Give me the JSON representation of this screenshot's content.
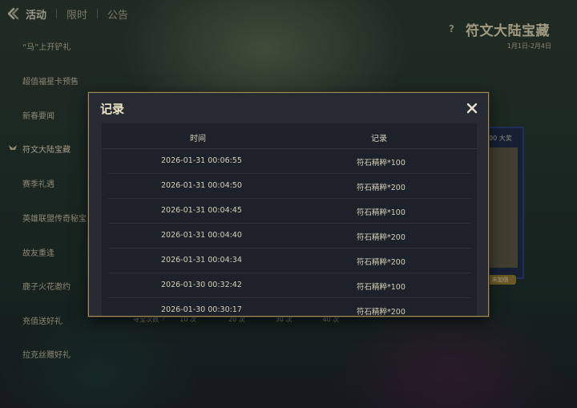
{
  "topnav": {
    "tab_activity": "活动",
    "tab_limited": "限时",
    "tab_notice": "公告"
  },
  "sidebar": {
    "items": [
      {
        "label": "“马”上开铲礼"
      },
      {
        "label": "超值福星卡预售"
      },
      {
        "label": "新春要闻"
      },
      {
        "label": "符文大陆宝藏"
      },
      {
        "label": "赛季礼遇"
      },
      {
        "label": "英雄联盟传奇秘宝"
      },
      {
        "label": "故友重逢"
      },
      {
        "label": "鹿子火花邀约"
      },
      {
        "label": "充值送好礼"
      },
      {
        "label": "拉克丝赠好礼"
      }
    ],
    "active_index": 3
  },
  "event": {
    "help": "?",
    "title": "符文大陆宝藏",
    "date": "1月1日-2月4日"
  },
  "background_panel": {
    "prize_text": "00 大奖",
    "badge_text": "末加倍",
    "count_label": "寻宝次数",
    "count_help": "?",
    "count_10": "10 次",
    "count_20": "20 次",
    "count_30": "30 次",
    "count_40": "40 次"
  },
  "modal": {
    "title": "记录",
    "columns": {
      "time": "时间",
      "record": "记录"
    },
    "rows": [
      {
        "time": "2026-01-31  00:06:55",
        "record": "符石精粹*100"
      },
      {
        "time": "2026-01-31  00:04:50",
        "record": "符石精粹*200"
      },
      {
        "time": "2026-01-31  00:04:45",
        "record": "符石精粹*100"
      },
      {
        "time": "2026-01-31  00:04:40",
        "record": "符石精粹*200"
      },
      {
        "time": "2026-01-31  00:04:34",
        "record": "符石精粹*200"
      },
      {
        "time": "2026-01-30  00:32:42",
        "record": "符石精粹*100"
      },
      {
        "time": "2026-01-30  00:30:17",
        "record": "符石精粹*200"
      }
    ]
  },
  "colors": {
    "gold_border": "#a08a55",
    "modal_bg": "#262a33",
    "table_bg": "#1d212a",
    "text_light": "#d7d0b8",
    "accent_blue": "#2d3f86"
  }
}
